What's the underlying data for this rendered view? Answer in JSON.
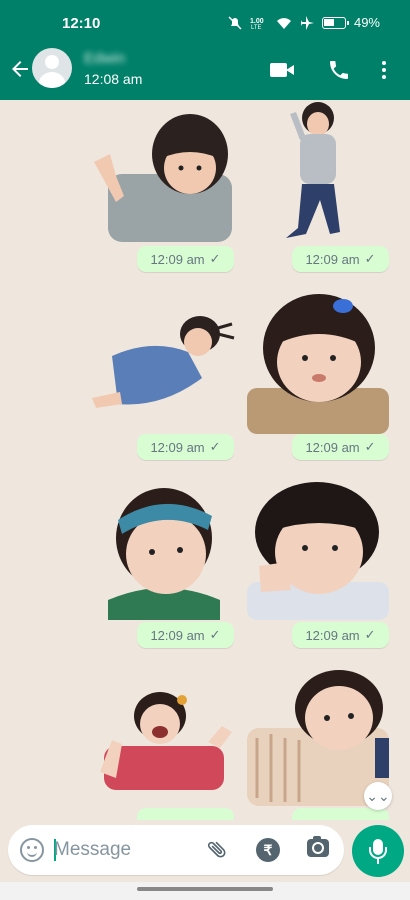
{
  "status_bar": {
    "time": "12:10",
    "indicators": [
      "mute-icon",
      "4g-lte-icon",
      "wifi-icon",
      "airplane-icon"
    ],
    "battery": "49%"
  },
  "header": {
    "back_icon": "arrow-left-icon",
    "contact_name": "Edwin",
    "last_seen": "12:08 am",
    "actions": [
      "video-call-icon",
      "phone-icon",
      "more-vert-icon"
    ]
  },
  "messages": [
    {
      "time": "12:09 am",
      "status": "✓",
      "sticker": "toddler-pointing"
    },
    {
      "time": "12:09 am",
      "status": "✓",
      "sticker": "toddler-standing"
    },
    {
      "time": "12:09 am",
      "status": "✓",
      "sticker": "toddler-lying-denim"
    },
    {
      "time": "12:09 am",
      "status": "✓",
      "sticker": "toddler-blue-clip"
    },
    {
      "time": "12:09 am",
      "status": "✓",
      "sticker": "toddler-headband"
    },
    {
      "time": "12:09 am",
      "status": "✓",
      "sticker": "toddler-hand-on-cheek"
    },
    {
      "time": "",
      "status": "",
      "sticker": "toddler-laughing"
    },
    {
      "time": "",
      "status": "",
      "sticker": "toddler-striped-shirt"
    }
  ],
  "scroll_down": "⌄⌄",
  "composer": {
    "placeholder": "Message",
    "value": "",
    "icons": [
      "emoji-icon",
      "attach-icon",
      "rupee-icon",
      "camera-icon",
      "mic-icon"
    ],
    "rupee_symbol": "₹"
  },
  "colors": {
    "header": "#008069",
    "chat_background": "#efe7dd",
    "outgoing_bubble": "#d9fdd3",
    "accent": "#00a884"
  }
}
